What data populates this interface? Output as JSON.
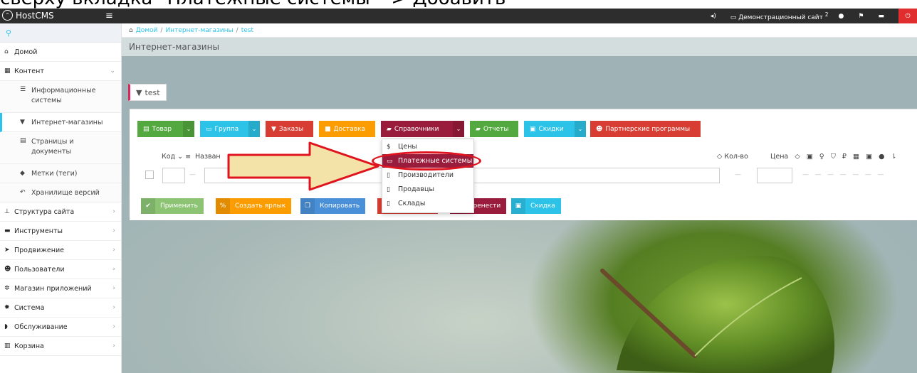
{
  "caption": "сверху вкладка \"Платежные системы\" -> Добавить",
  "topbar": {
    "brand": "HostCMS",
    "site_label": "Демонстрационный сайт",
    "badge": "2"
  },
  "sidebar": {
    "items": [
      {
        "label": "Домой",
        "icon": "home-icon"
      },
      {
        "label": "Контент",
        "icon": "newspaper-icon"
      },
      {
        "label": "Информационные системы",
        "icon": "list-icon"
      },
      {
        "label": "Интернет-магазины",
        "icon": "cart-icon"
      },
      {
        "label": "Страницы и документы",
        "icon": "document-icon"
      },
      {
        "label": "Метки (теги)",
        "icon": "tag-icon"
      },
      {
        "label": "Хранилище версий",
        "icon": "history-icon"
      },
      {
        "label": "Структура сайта",
        "icon": "sitemap-icon"
      },
      {
        "label": "Инструменты",
        "icon": "briefcase-icon"
      },
      {
        "label": "Продвижение",
        "icon": "rocket-icon"
      },
      {
        "label": "Пользователи",
        "icon": "users-icon"
      },
      {
        "label": "Магазин приложений",
        "icon": "cogs-icon"
      },
      {
        "label": "Система",
        "icon": "gear-icon"
      },
      {
        "label": "Обслуживание",
        "icon": "shield-icon"
      },
      {
        "label": "Корзина",
        "icon": "trash-icon"
      }
    ]
  },
  "breadcrumb": [
    "Домой",
    "Интернет-магазины",
    "test"
  ],
  "page_title": "Интернет-магазины",
  "tab_label": "test",
  "toolbar": {
    "product": "Товар",
    "group": "Группа",
    "orders": "Заказы",
    "delivery": "Доставка",
    "directories": "Справочники",
    "reports": "Отчеты",
    "discounts": "Скидки",
    "partners": "Партнерские программы"
  },
  "grid": {
    "col_code": "Код",
    "col_name": "Назван",
    "col_qty": "Кол-во",
    "col_price": "Цена",
    "dash": "—"
  },
  "actions": {
    "apply": "Применить",
    "shortcut": "Создать ярлык",
    "copy": "Копировать",
    "move": "еренести",
    "discount": "Скидка"
  },
  "dropdown": {
    "items": [
      "Цены",
      "Платежные системы",
      "Производители",
      "Продавцы",
      "Склады"
    ]
  },
  "colors": {
    "green": "#53a93f",
    "blue": "#2dc3e8",
    "red": "#d73d32",
    "orange": "#fb9c00",
    "maroon": "#9a1c3c",
    "highlight_oval": "#e0141e",
    "arrow_fill": "#f3e3a8"
  }
}
